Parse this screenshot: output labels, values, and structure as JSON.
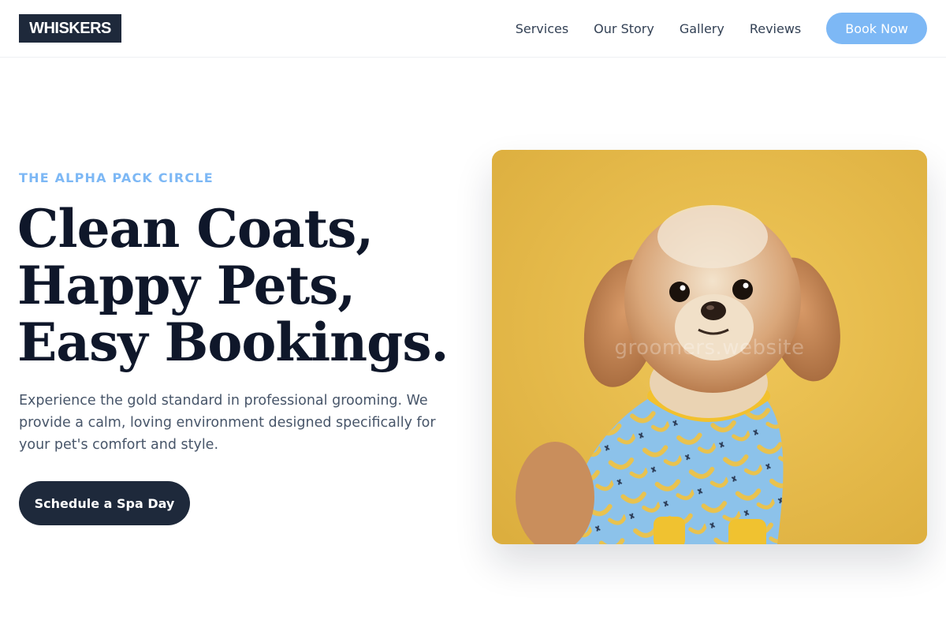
{
  "header": {
    "logo": "WHISKERS",
    "nav": [
      "Services",
      "Our Story",
      "Gallery",
      "Reviews"
    ],
    "book_button": "Book Now"
  },
  "hero": {
    "eyebrow": "THE ALPHA PACK CIRCLE",
    "headline": [
      "Clean Coats,",
      "Happy Pets,",
      "Easy Bookings."
    ],
    "lead": "Experience the gold standard in professional grooming. We provide a calm, loving environment designed specifically for your pet's comfort and style.",
    "cta": "Schedule a Spa Day"
  },
  "image": {
    "subject": "small fluffy dog wearing blue banana-print shirt on yellow background",
    "watermark": "groomers.website"
  },
  "colors": {
    "navy": "#1e293b",
    "accent_blue": "#7db8f5",
    "photo_yellow": "#e8bf4e",
    "shirt_blue": "#8cc2ea"
  }
}
